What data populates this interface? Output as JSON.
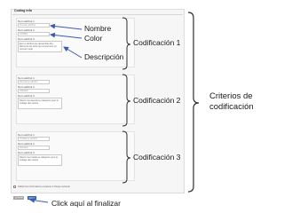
{
  "form": {
    "title": "Coding info",
    "sections": [
      {
        "name_label": "Nom attribut 1",
        "name_value": "Premier attribut",
        "color_label": "Nom attribut 2",
        "color_value": "#1f78b4",
        "desc_label": "Nom attribut 3",
        "desc_value": "Est un attribut qui rassemble des éléments du texte qui concernent un premier sujet"
      },
      {
        "name_label": "Nom attribut 1",
        "name_value": "Deuxième attribut",
        "color_label": "Nom attribut 2",
        "color_value": "#33a02c",
        "desc_label": "Nom attribut 3",
        "desc_value": "Décrit une deuxième catégorie pour le codage des textes"
      },
      {
        "name_label": "Nom attribut 1",
        "name_value": "Troisième attribut",
        "color_label": "Nom attribut 2",
        "color_value": "#e31a1c",
        "desc_label": "Nom attribut 3",
        "desc_value": "Décrit une troisième catégorie pour le codage des textes"
      }
    ],
    "checkbox_text": "Valider les informations et passer à l'étape suivante",
    "back_button": "Previous",
    "finish_button": "Finish"
  },
  "annotations": {
    "nombre": "Nombre",
    "color": "Color",
    "descripcion": "Descripción",
    "cod1": "Codificación 1",
    "cod2": "Codificación 2",
    "cod3": "Codificación 3",
    "criterios_line1": "Criterios de",
    "criterios_line2": "codificación",
    "click_finalizar": "Click aquí al finalizar"
  },
  "colors": {
    "arrow": "#3b5bb5",
    "bracket": "#2e2e2e",
    "primary_button": "#2f6dc2"
  }
}
